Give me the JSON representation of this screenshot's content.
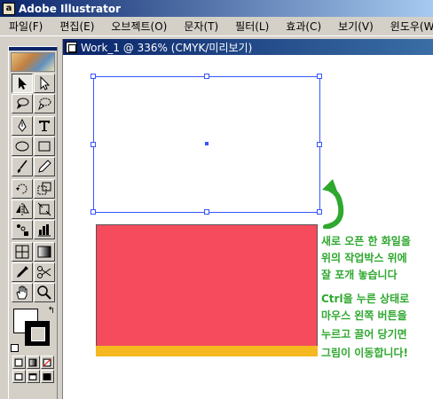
{
  "app": {
    "title": "Adobe Illustrator",
    "icon_text": "a"
  },
  "menu": {
    "items": [
      "파일(F)",
      "편집(E)",
      "오브젝트(O)",
      "문자(T)",
      "필터(L)",
      "효과(C)",
      "보기(V)",
      "윈도우(W)"
    ]
  },
  "toolbox": {
    "tools": [
      "selection-tool",
      "direct-selection-tool",
      "lasso-tool",
      "direct-lasso-tool",
      "pen-tool",
      "type-tool",
      "ellipse-tool",
      "rectangle-tool",
      "paintbrush-tool",
      "pencil-tool",
      "rotate-tool",
      "scale-tool",
      "reflect-tool",
      "free-transform-tool",
      "symbol-sprayer-tool",
      "graph-tool",
      "mesh-tool",
      "gradient-tool",
      "eyedropper-tool",
      "scissors-tool",
      "hand-tool",
      "zoom-tool"
    ],
    "active_tool": "selection-tool"
  },
  "document": {
    "title": "Work_1 @ 336% (CMYK/미리보기)"
  },
  "colors": {
    "pasted_fill": "#f54b5c",
    "pasted_strip": "#f5b820",
    "selection": "#3355ff",
    "note_text": "#2ea82e"
  },
  "instructions": {
    "line1": "새로 오픈 한 화일을",
    "line2": "위의 작업박스 위에",
    "line3": "잘 포개 놓습니다",
    "line4": "Ctrl을 누른 상태로",
    "line5": "마우스 왼쪽 버튼을",
    "line6": "누르고 끌어 당기면",
    "line7": "그림이 이동합니다!"
  }
}
